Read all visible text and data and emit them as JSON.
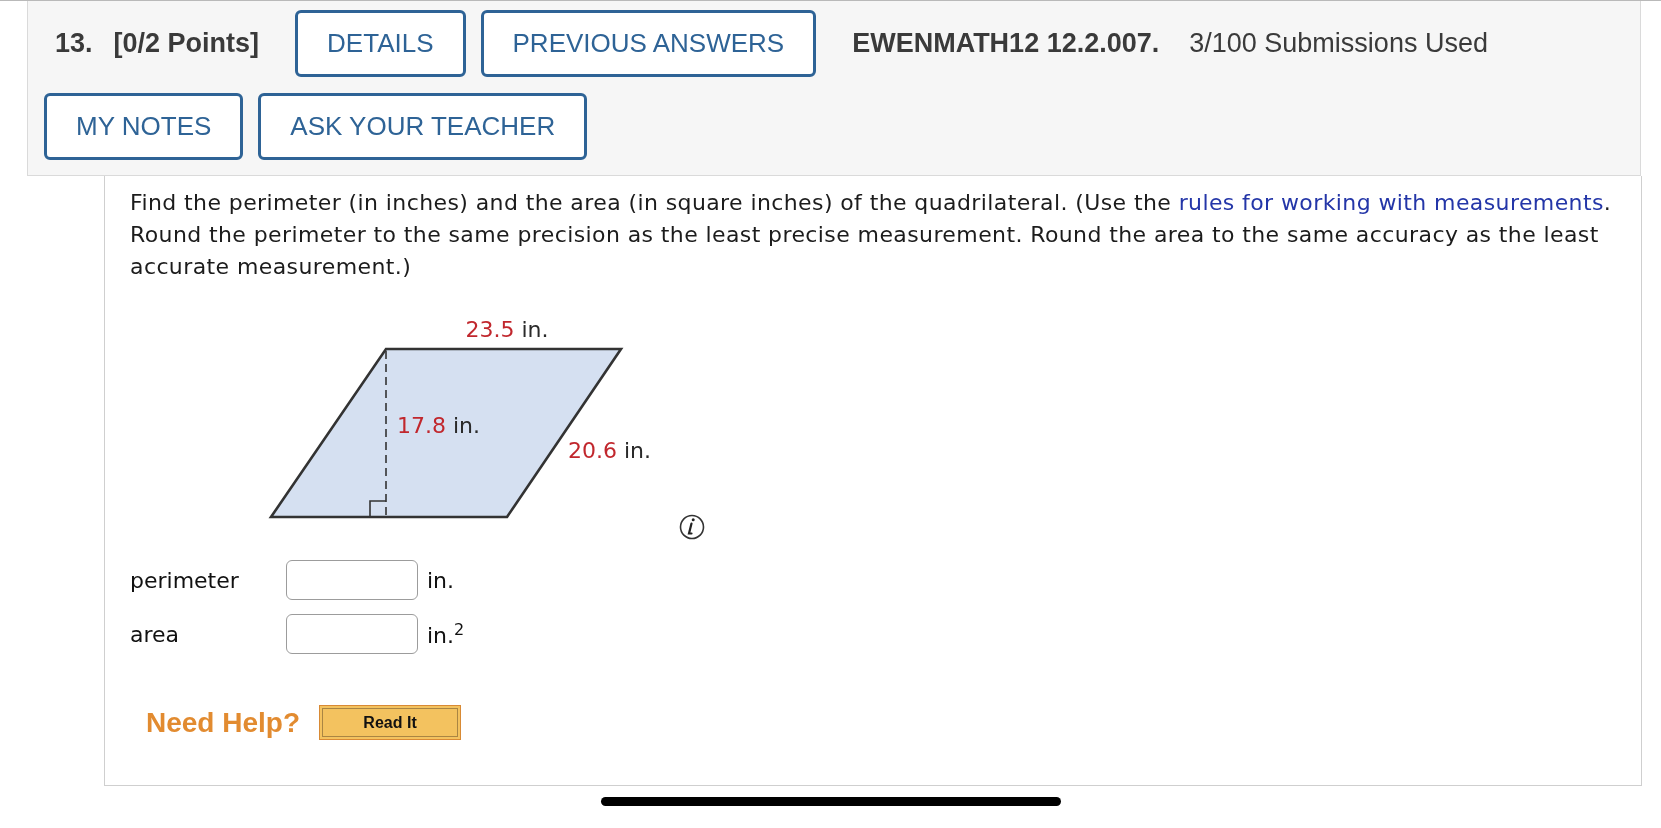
{
  "header": {
    "number": "13.",
    "points": "[0/2 Points]",
    "buttons": [
      "DETAILS",
      "PREVIOUS ANSWERS"
    ],
    "code": "EWENMATH12 12.2.007.",
    "submissions": "3/100 Submissions Used",
    "tools": [
      "MY NOTES",
      "ASK YOUR TEACHER"
    ]
  },
  "question": {
    "text_before": "Find the perimeter (in inches) and the area (in square inches) of the quadrilateral. (Use the ",
    "link": "rules for working with measurements",
    "text_after": ". Round the perimeter to the same precision as the least precise measurement. Round the area to the same accuracy as the least accurate measurement.)"
  },
  "figure": {
    "labels": [
      {
        "value": "23.5",
        "unit": "in."
      },
      {
        "value": "17.8",
        "unit": "in."
      },
      {
        "value": "20.6",
        "unit": "in."
      }
    ]
  },
  "answers": [
    {
      "label": "perimeter",
      "unit": "in."
    },
    {
      "label": "area",
      "unit": "in.$^{2}$"
    }
  ],
  "help": {
    "title": "Need Help?",
    "buttons": [
      "Read It"
    ]
  }
}
